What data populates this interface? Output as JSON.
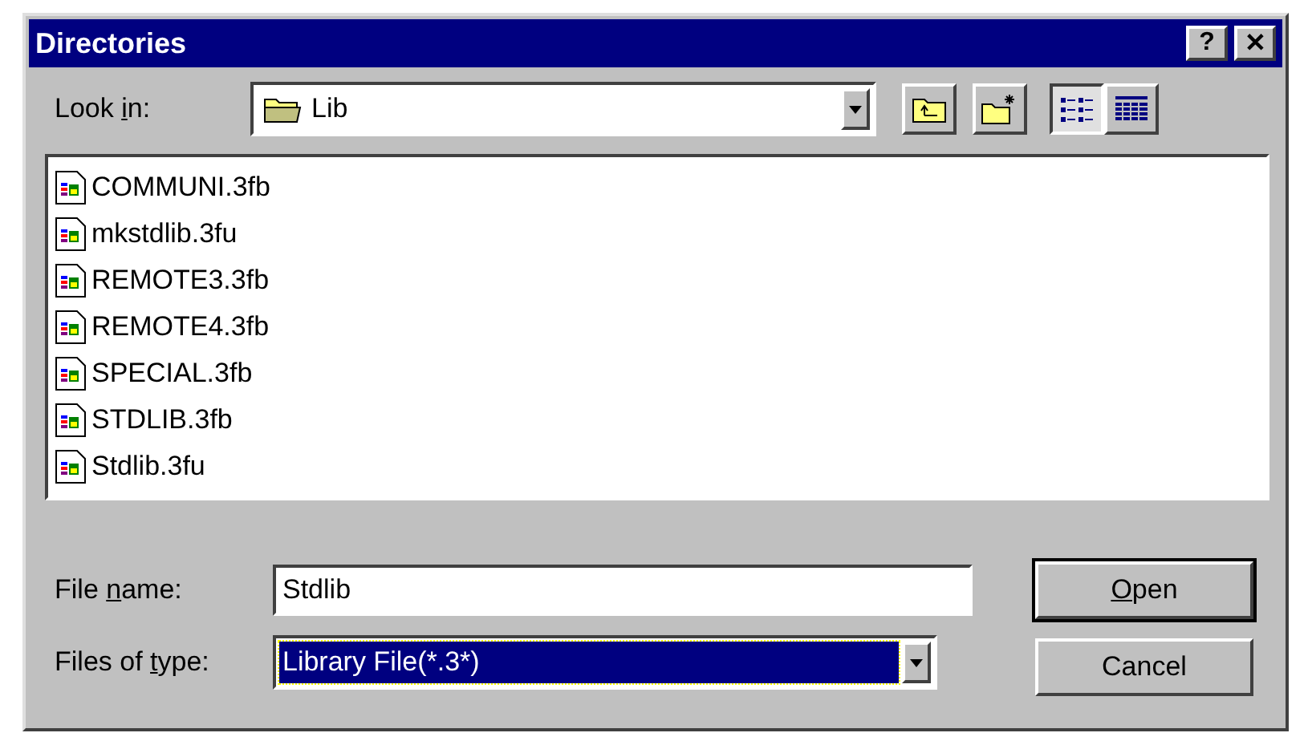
{
  "window": {
    "title": "Directories",
    "help_button": "?",
    "close_button": "✕"
  },
  "look_in": {
    "label": {
      "before": "Look ",
      "key": "i",
      "after": "n:"
    },
    "value": "Lib"
  },
  "view_buttons": [
    {
      "kind": "list",
      "selected": true
    },
    {
      "kind": "details",
      "selected": false
    }
  ],
  "files": [
    {
      "name": "COMMUNI.3fb"
    },
    {
      "name": "mkstdlib.3fu"
    },
    {
      "name": "REMOTE3.3fb"
    },
    {
      "name": "REMOTE4.3fb"
    },
    {
      "name": "SPECIAL.3fb"
    },
    {
      "name": "STDLIB.3fb"
    },
    {
      "name": "Stdlib.3fu"
    }
  ],
  "file_name": {
    "label": {
      "before": "File ",
      "key": "n",
      "after": "ame:"
    },
    "value": "Stdlib"
  },
  "files_of_type": {
    "label": {
      "before": "Files of ",
      "key": "t",
      "after": "ype:"
    },
    "value": "Library File(*.3*)",
    "selected": true
  },
  "buttons": [
    {
      "label": {
        "key": "O",
        "after": "pen"
      },
      "default": true
    },
    {
      "label": {
        "before": "Cancel"
      },
      "default": false
    }
  ]
}
